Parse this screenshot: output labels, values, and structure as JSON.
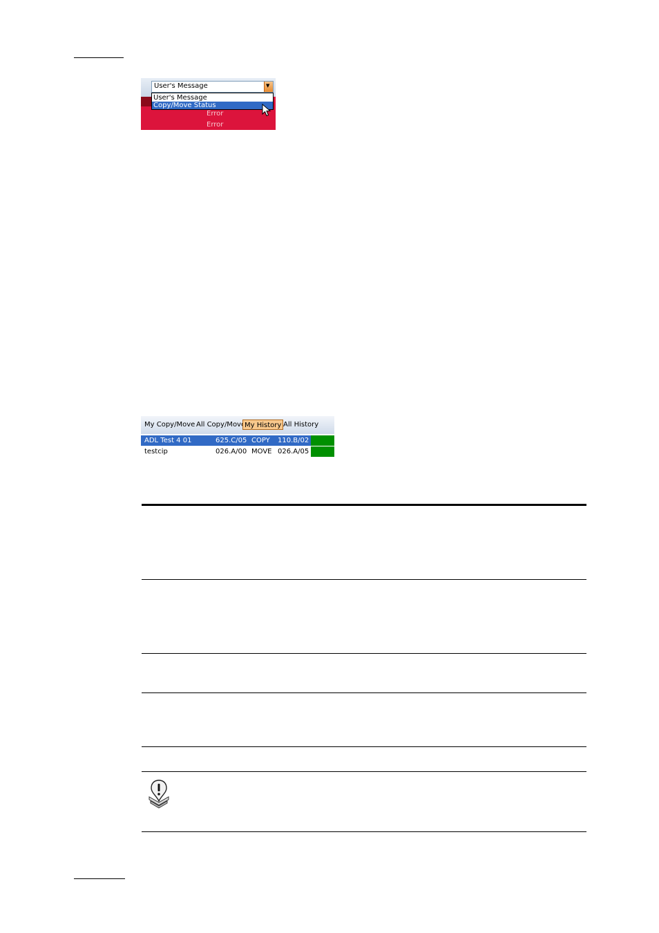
{
  "dropdown_screenshot": {
    "selected_value": "User's Message",
    "options": [
      "User's Message",
      "Copy/Move Status"
    ],
    "background_rows": [
      "Error",
      "Error"
    ],
    "colors": {
      "error_red": "#dc143c",
      "selection_blue": "#316ac5",
      "button_orange": "#e88a2e"
    }
  },
  "history_screenshot": {
    "tabs": [
      "My Copy/Move",
      "All Copy/Move",
      "My History",
      "All History"
    ],
    "active_tab": "My History",
    "rows": [
      {
        "name": "ADL Test 4 01",
        "source": "625.C/05",
        "action": "COPY",
        "destination": "110.B/02",
        "status_color": "#009000",
        "selected": true
      },
      {
        "name": "testcip",
        "source": "026.A/00",
        "action": "MOVE",
        "destination": "026.A/05",
        "status_color": "#009000",
        "selected": false
      }
    ]
  },
  "icons": {
    "note": "note-exclamation-icon",
    "cursor": "mouse-pointer-icon"
  }
}
